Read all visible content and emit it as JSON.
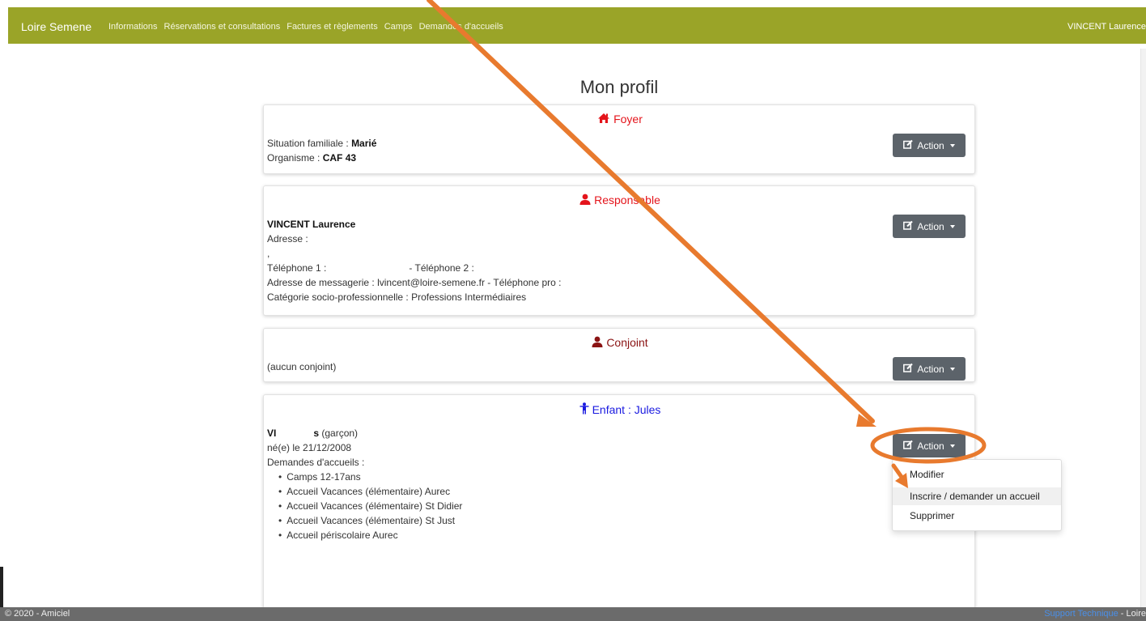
{
  "navbar": {
    "brand": "Loire Semene",
    "items": [
      "Informations",
      "Réservations et consultations",
      "Factures et règlements",
      "Camps",
      "Demandes d'accueils"
    ],
    "user": "VINCENT Laurence"
  },
  "page_title": "Mon profil",
  "foyer": {
    "title": "Foyer",
    "situation_label": "Situation familiale : ",
    "situation_value": "Marié",
    "organisme_label": "Organisme : ",
    "organisme_value": "CAF 43",
    "action_label": "Action"
  },
  "responsable": {
    "title": "Responsable",
    "name": "VINCENT Laurence",
    "adresse": "Adresse :",
    "adresse_line": ",",
    "telephone_1": "Téléphone 1 :",
    "telephone_2": "- Téléphone 2 :",
    "messagerie": "Adresse de messagerie : lvincent@loire-semene.fr - Téléphone pro :",
    "categorie": "Catégorie socio-professionnelle : Professions Intermédiaires",
    "action_label": "Action"
  },
  "conjoint": {
    "title": "Conjoint",
    "text": "(aucun conjoint)",
    "action_label": "Action"
  },
  "enfant": {
    "title": "Enfant : Jules",
    "name_start": "VI",
    "name_end": "s",
    "gender": " (garçon)",
    "birth": "né(e) le 21/12/2008",
    "demandes_label": "Demandes d'accueils :",
    "demandes": [
      "Camps 12-17ans",
      "Accueil Vacances (élémentaire) Aurec",
      "Accueil Vacances (élémentaire) St Didier",
      "Accueil Vacances (élémentaire) St Just",
      "Accueil périscolaire Aurec"
    ],
    "action_label": "Action"
  },
  "dropdown": {
    "items": [
      "Modifier",
      "Inscrire / demander un accueil",
      "Supprimer"
    ]
  },
  "footer": {
    "copyright": "© 2020 - Amiciel",
    "support": "Support Technique",
    "suffix": " - Loire"
  },
  "colors": {
    "navbar": "#9aa428",
    "foyer_title": "#e4141b",
    "responsable_title": "#e4141b",
    "conjoint_title": "#8b1414",
    "enfant_title": "#1a1ae0",
    "annotation": "#e87a2e",
    "button": "#5c636a"
  },
  "icons": {
    "foyer": "home-icon",
    "responsable": "user-icon",
    "conjoint": "user-icon",
    "enfant": "child-icon",
    "action": "edit-icon"
  }
}
